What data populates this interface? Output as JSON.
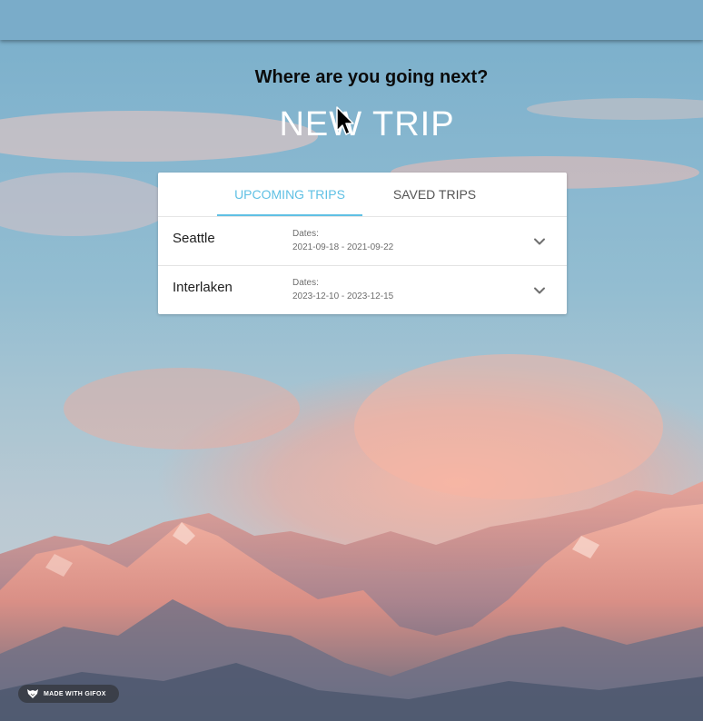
{
  "header": {
    "question": "Where are you going next?",
    "new_trip_label": "NEW TRIP"
  },
  "tabs": [
    {
      "label": "UPCOMING TRIPS",
      "active": true
    },
    {
      "label": "SAVED TRIPS",
      "active": false
    }
  ],
  "trips": [
    {
      "name": "Seattle",
      "dates_label": "Dates:",
      "dates": "2021-09-18 - 2021-09-22"
    },
    {
      "name": "Interlaken",
      "dates_label": "Dates:",
      "dates": "2023-12-10 - 2023-12-15"
    }
  ],
  "watermark": {
    "text": "MADE WITH GIFOX",
    "icon": "fox-icon"
  },
  "colors": {
    "accent": "#5fc0e4",
    "panel_bg": "#ffffff",
    "top_bar": "#7aacc9"
  }
}
